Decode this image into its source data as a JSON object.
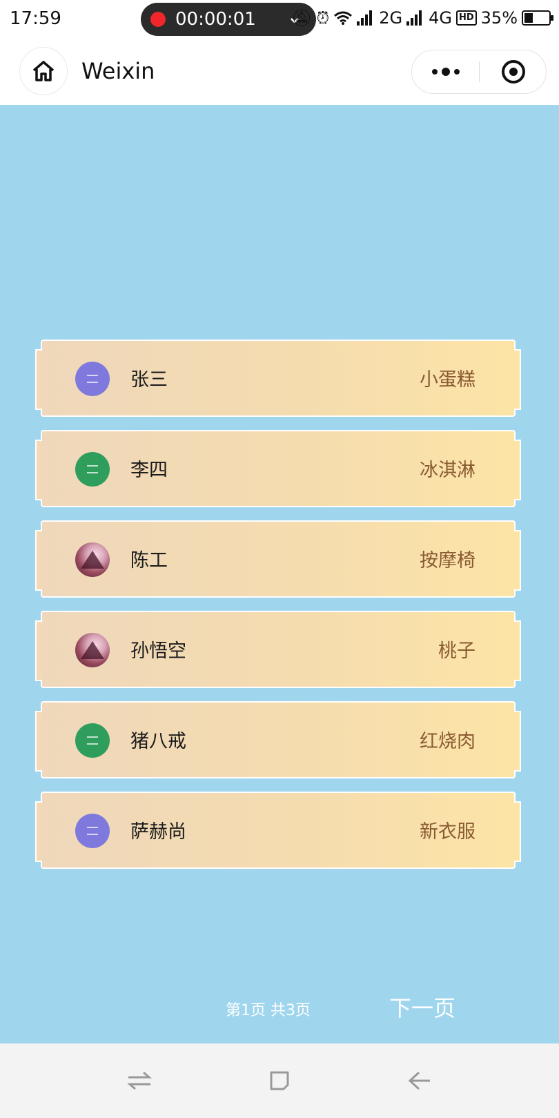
{
  "status_bar": {
    "time": "17:59",
    "recording_time": "00:00:01",
    "network_2g": "2G",
    "network_4g": "4G",
    "hd": "HD",
    "battery": "35%",
    "battery_level": 0.35
  },
  "nav": {
    "title": "Weixin",
    "home_icon": "home-icon",
    "more_icon": "more-dots-icon",
    "close_icon": "target-ring-icon"
  },
  "list": [
    {
      "name": "张三",
      "item": "小蛋糕",
      "avatar": "purple"
    },
    {
      "name": "李四",
      "item": "冰淇淋",
      "avatar": "green"
    },
    {
      "name": "陈工",
      "item": "按摩椅",
      "avatar": "photo"
    },
    {
      "name": "孙悟空",
      "item": "桃子",
      "avatar": "photo"
    },
    {
      "name": "猪八戒",
      "item": "红烧肉",
      "avatar": "green"
    },
    {
      "name": "萨赫尚",
      "item": "新衣服",
      "avatar": "purple"
    }
  ],
  "pager": {
    "text": "第1页 共3页",
    "next": "下一页"
  },
  "colors": {
    "background": "#9fd6ee",
    "card_left": "#efd8bb",
    "card_right": "#fce4a6",
    "item_text": "#8a5a32"
  }
}
